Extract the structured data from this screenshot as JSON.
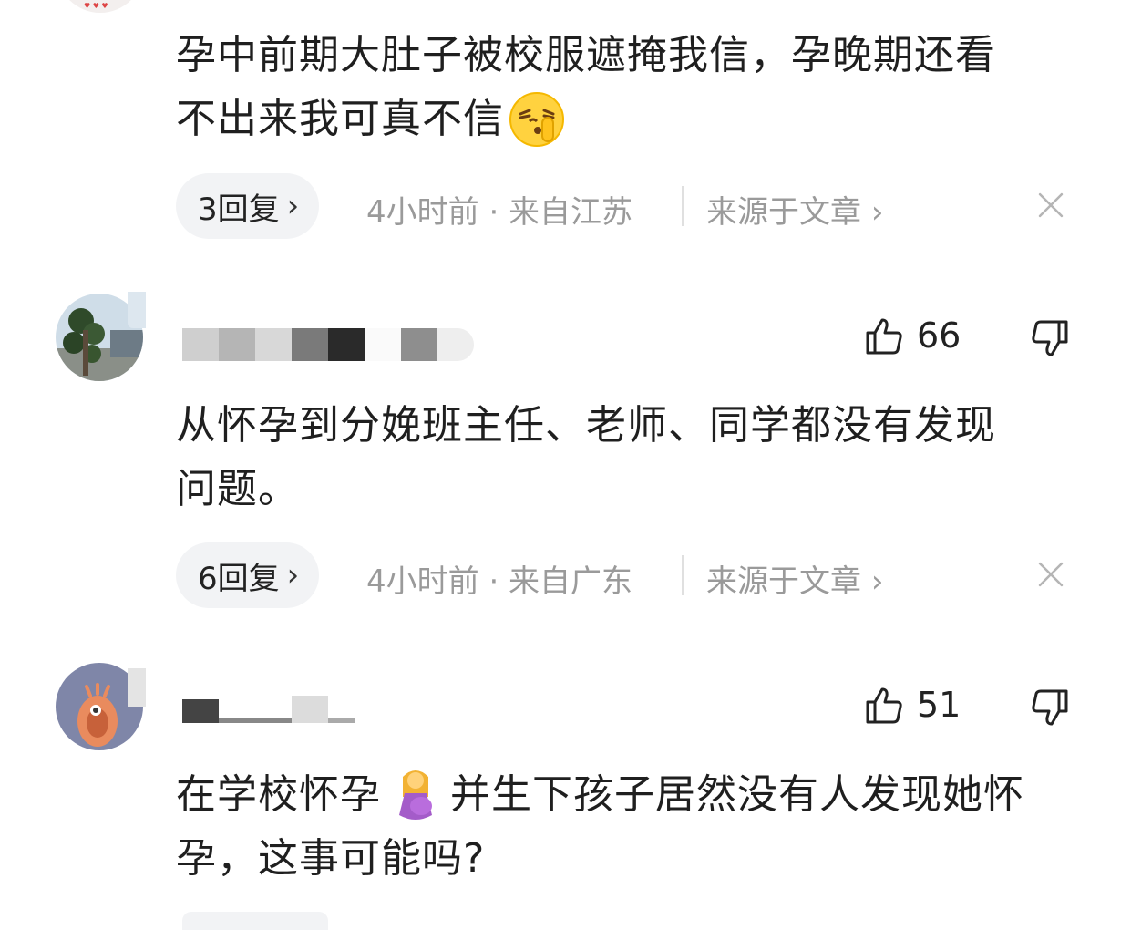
{
  "comments": [
    {
      "text_line1": "孕中前期大肚子被校服遮掩我信，孕晚期还看",
      "text_line2": "不出来我可真不信",
      "emoji": "shushing-face-emoji",
      "replies_label": "3回复",
      "time_location": "4小时前 · 来自江苏",
      "source_label": "来源于文章"
    },
    {
      "username": "████████",
      "likes": "66",
      "text_line1": "从怀孕到分娩班主任、老师、同学都没有发现",
      "text_line2": "问题。",
      "replies_label": "6回复",
      "time_location": "4小时前 · 来自广东",
      "source_label": "来源于文章"
    },
    {
      "username": "██████",
      "likes": "51",
      "text_line1_a": "在学校怀孕",
      "emoji": "pregnant-woman-emoji",
      "text_line1_b": "并生下孩子居然没有人发现她怀",
      "text_line2": "孕，这事可能吗?"
    }
  ],
  "icons": {
    "like": "thumbs-up-icon",
    "dislike": "thumbs-down-icon",
    "close": "close-icon",
    "chevron": "chevron-right-icon"
  },
  "colors": {
    "meta_gray": "#9a9a9a",
    "pill_bg": "#f2f3f5",
    "text": "#1f1f1f"
  }
}
